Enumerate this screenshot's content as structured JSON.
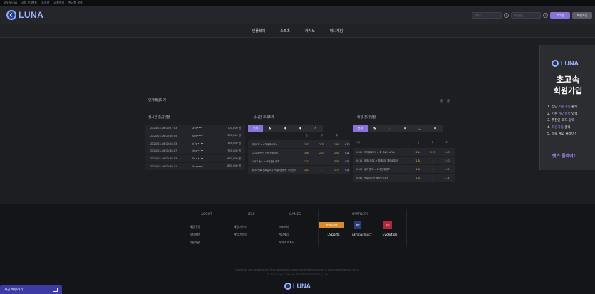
{
  "topbar": {
    "items": [
      "00:00:00",
      "공지 / 이벤트",
      "도움말",
      "공지알림",
      "현금형 목록"
    ]
  },
  "header": {
    "logo_text": "LUNA",
    "id_placeholder": "아이디",
    "pw_placeholder": "비밀번호",
    "login_label": "로그인",
    "join_label": "회원가입"
  },
  "nav": {
    "items": [
      "인플레이",
      "스포츠",
      "카지노",
      "미니게임"
    ]
  },
  "banner": {
    "logo_text": "LUNA",
    "title1": "초고속",
    "title2": "회원가입",
    "steps": [
      {
        "pre": "1. 상단 ",
        "hl": "회원가입",
        "post": " 클릭"
      },
      {
        "pre": "2. 기본 ",
        "hl": "개인정보",
        "post": " 입력"
      },
      {
        "pre": "3. 추천인 코드 입력",
        "hl": "",
        "post": ""
      },
      {
        "pre": "4. ",
        "hl": "회원가입",
        "post": " 클릭"
      },
      {
        "pre": "5. 바로 게임 플레이!",
        "hl": "",
        "post": ""
      }
    ],
    "cta": "렛츠 플레이!"
  },
  "panel": {
    "title": "인기배팅표기",
    "withdrawals_title": "실시간 출금현황",
    "combo_title": "실시간 크게적재",
    "upcoming_title": "예정 경기일정",
    "withdrawals": [
      {
        "date": "2024-03-16 00:37:53",
        "user": "sccc••••",
        "amount": "700,000 원"
      },
      {
        "date": "2024-03-16 00:16:55",
        "user": "lsrfp••••",
        "amount": "500,000 원"
      },
      {
        "date": "2024-03-16 00:28:13",
        "user": "ln7w••••",
        "amount": "190,000 원"
      },
      {
        "date": "2024-03-16 00:38:07",
        "user": "kkye••••",
        "amount": "730,000 원"
      },
      {
        "date": "2024-03-16 00:38:03",
        "user": "7bus••••",
        "amount": "660,000 원"
      },
      {
        "date": "2024-03-16 00:38:41",
        "user": "1thc••••",
        "amount": "830,000 원"
      }
    ],
    "combo_tabs": [
      "전체",
      "⚽",
      "●",
      "●",
      "✓"
    ],
    "combo_head": [
      "승",
      "무",
      "패"
    ],
    "combo_rows": [
      {
        "team": "파비르로 ↔ CD 올레스포노",
        "o1": "1.52",
        "o2": "2.75",
        "o3": "1.82",
        "x": "+20"
      },
      {
        "team": "CA 마르린 ↔ 인테 플레이드",
        "o1": "3.95",
        "o2": "2.25",
        "o3": "2.00",
        "x": "+22"
      },
      {
        "team": "시라고 볼스 ↔ 브뤼클린 네츠",
        "o1": "1.21",
        "o2": "-",
        "o3": "3.57",
        "x": "+22"
      },
      {
        "team": "플라스엑로 센트럴스나 ↔ 클리블랜드 가디언스",
        "o1": "2.03",
        "o2": "-",
        "o3": "1.77",
        "x": "+22"
      }
    ],
    "upcoming_tabs": [
      "전체",
      "⚽",
      "✓",
      "●",
      "🏒",
      "●"
    ],
    "upcoming_head": [
      "시작",
      "승",
      "무",
      "패"
    ],
    "upcoming_rows": [
      {
        "time": "00:00",
        "team": "프라페르 FC ↔ 피 그로스 AFAL",
        "o1": "2.10",
        "o2": "3.17",
        "o3": "1.63"
      },
      {
        "time": "00:15",
        "team": "테레나미르 ↔ 피테리트 헬레네알아",
        "o1": "1.84",
        "o2": "-",
        "o3": "2.10"
      },
      {
        "time": "00:30",
        "team": "길리 윙크 ↔ 도사진 워팬츠",
        "o1": "1.80",
        "o2": "-",
        "o3": "1.95"
      },
      {
        "time": "00:45",
        "team": "센트랄스 ↔ 세리빈스코프",
        "o1": "1.65",
        "o2": "-",
        "o3": "2.14"
      }
    ]
  },
  "footer": {
    "about_title": "ABOUT",
    "help_title": "HELP",
    "games_title": "GAMES",
    "partners_title": "PARTNERS",
    "about_links": [
      "배팅 규정",
      "공지사항",
      "이용약관"
    ],
    "help_links": [
      "배팅 가이드",
      "게임 가이드"
    ],
    "games_links": [
      "스포츠북",
      "가상게임",
      "라이브 카지노"
    ],
    "partners": [
      "BETRADAR",
      "BET",
      "IDC",
      "LSports",
      "BETCONSTRUCT",
      "Evolution"
    ],
    "copy1": "Gambling can be addictive. Play responsibly. www.gamblingtherapy.org & www.gambleaware.co.uk.",
    "copy2": "© 2024 Luna.COM, Inc. RIGHTS RESERVED. | 18+"
  },
  "chat": {
    "label": "지금 채팅하기"
  }
}
